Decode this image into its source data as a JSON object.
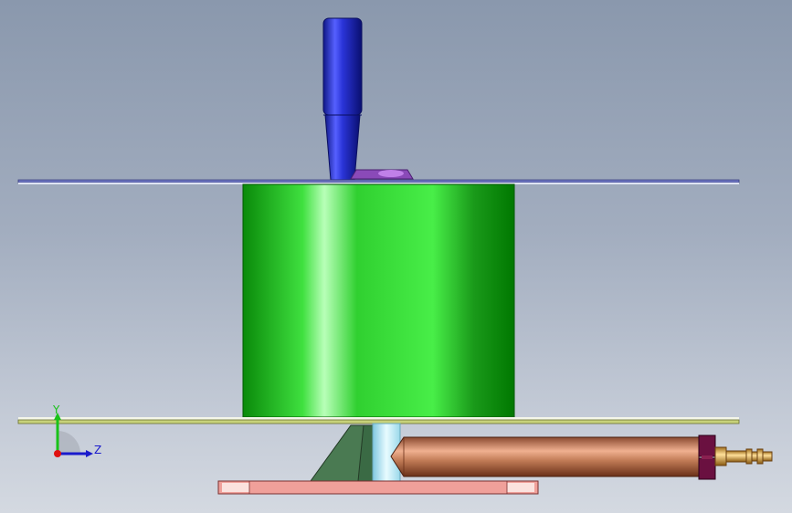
{
  "viewport": {
    "background_top": "#8a98ad",
    "background_bottom": "#d4d9e1"
  },
  "model": {
    "parts": [
      {
        "name": "handle",
        "color": "#1a22b8"
      },
      {
        "name": "top-plate",
        "color": "#7f86c8"
      },
      {
        "name": "hex-nut",
        "color": "#8a4ab8"
      },
      {
        "name": "cylinder",
        "color": "#1fbf1f"
      },
      {
        "name": "bottom-plate",
        "color": "#c7d27a"
      },
      {
        "name": "gusset",
        "color": "#4a7a52"
      },
      {
        "name": "pin",
        "color": "#bfe8f2"
      },
      {
        "name": "base-plate",
        "color": "#f0a09a"
      },
      {
        "name": "air-cylinder",
        "color": "#b87050"
      },
      {
        "name": "cylinder-end-cap",
        "color": "#6a1040"
      },
      {
        "name": "air-fitting",
        "color": "#d9a84a"
      }
    ]
  },
  "triad": {
    "y_label": "Y",
    "z_label": "Z",
    "y_color": "#19c219",
    "z_color": "#1a1acc",
    "x_color": "#e01010"
  }
}
